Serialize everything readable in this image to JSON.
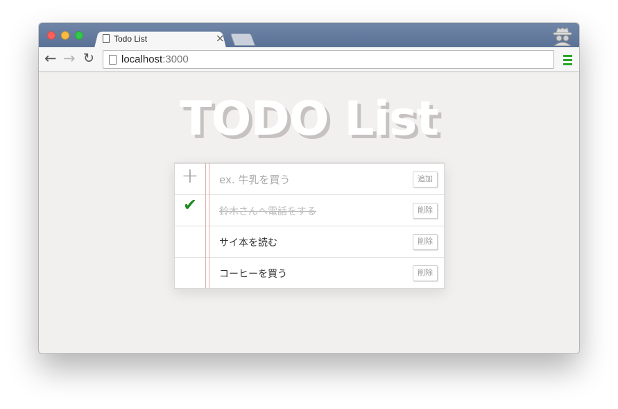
{
  "browser": {
    "tab_title": "Todo List",
    "tab_close": "×",
    "url_host": "localhost",
    "url_port": ":3000"
  },
  "page": {
    "heading": "TODO List"
  },
  "new_item": {
    "placeholder": "ex. 牛乳を買う",
    "add_label": "追加"
  },
  "items": [
    {
      "text": "鈴木さんへ電話をする",
      "done": true,
      "delete_label": "削除"
    },
    {
      "text": "サイ本を読む",
      "done": false,
      "delete_label": "削除"
    },
    {
      "text": "コーヒーを買う",
      "done": false,
      "delete_label": "削除"
    }
  ],
  "colors": {
    "titlebar": "#5f7699",
    "check": "#1e8a1e",
    "menu": "#2aa52a"
  }
}
